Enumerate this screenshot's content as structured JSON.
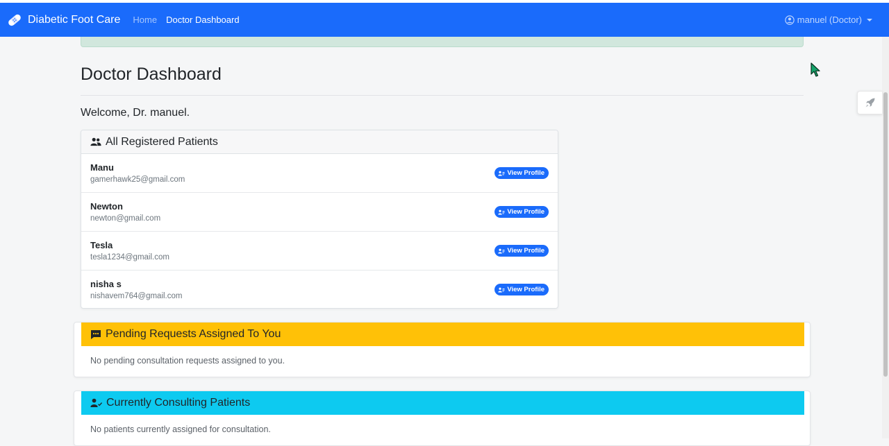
{
  "navbar": {
    "brand": "Diabetic Foot Care",
    "links": [
      {
        "label": "Home",
        "active": false
      },
      {
        "label": "Doctor Dashboard",
        "active": true
      }
    ],
    "user_menu": "manuel (Doctor)",
    "brand_icon": "bandage-icon",
    "user_icon": "user-circle-icon"
  },
  "main": {
    "title": "Doctor Dashboard",
    "welcome": "Welcome, Dr. manuel."
  },
  "patients": {
    "header": "All Registered Patients",
    "header_icon": "users-icon",
    "button_label": "View Profile",
    "list": [
      {
        "name": "Manu",
        "email": "gamerhawk25@gmail.com"
      },
      {
        "name": "Newton",
        "email": "newton@gmail.com"
      },
      {
        "name": "Tesla",
        "email": "tesla1234@gmail.com"
      },
      {
        "name": "nisha s",
        "email": "nishavem764@gmail.com"
      }
    ]
  },
  "pending": {
    "header": "Pending Requests Assigned To You",
    "header_icon": "comment-dots-icon",
    "empty_text": "No pending consultation requests assigned to you.",
    "color": "#ffc107"
  },
  "consulting": {
    "header": "Currently Consulting Patients",
    "header_icon": "user-check-icon",
    "empty_text": "No patients currently assigned for consultation.",
    "color": "#0dcaf0"
  },
  "colors": {
    "navbar": "#1a6bfb",
    "primary_button": "#1a6bfb",
    "alert_success": "#d1e7dd"
  },
  "side_widget_icon": "rocket-icon"
}
